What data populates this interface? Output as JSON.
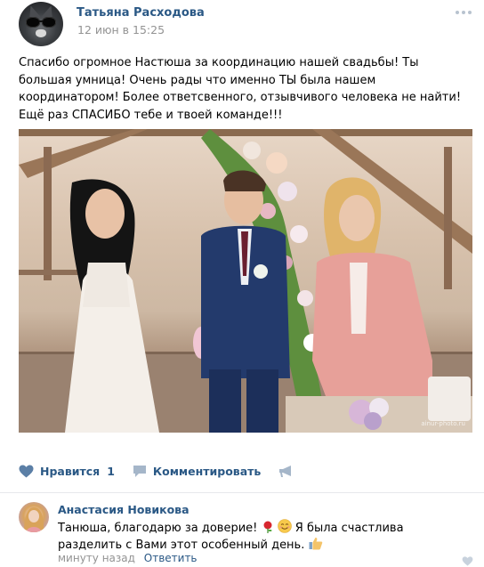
{
  "post": {
    "author": "Татьяна Расходова",
    "date": "12 июн в 15:25",
    "text": "Спасибо огромное Настюша за координацию нашей свадьбы! Ты большая умница! Очень рады что именно ТЫ была нашем координатором! Более ответсвенного, отзывчивого человека не найти! Ещё раз СПАСИБО тебе и твоей команде!!!",
    "photo_watermark": "ainur-photo.ru",
    "like_label": "Нравится",
    "like_count": "1",
    "comment_label": "Комментировать"
  },
  "comment": {
    "author": "Анастасия Новикова",
    "text_part1": "Танюша, благодарю за доверие!",
    "text_part2": "Я была счастлива разделить с Вами этот особенный день.",
    "time": "минуту назад",
    "reply_label": "Ответить"
  },
  "icons": {
    "like": "heart-icon",
    "comment": "speech-bubble-icon",
    "share": "megaphone-icon",
    "more": "dots-icon",
    "comment_like": "heart-icon",
    "emoji_1": "rose-icon",
    "emoji_2": "smiling-face-icon",
    "emoji_3": "thumbs-up-icon"
  },
  "colors": {
    "link": "#2a5885",
    "muted": "#939393",
    "icon": "#5b7fa6"
  }
}
